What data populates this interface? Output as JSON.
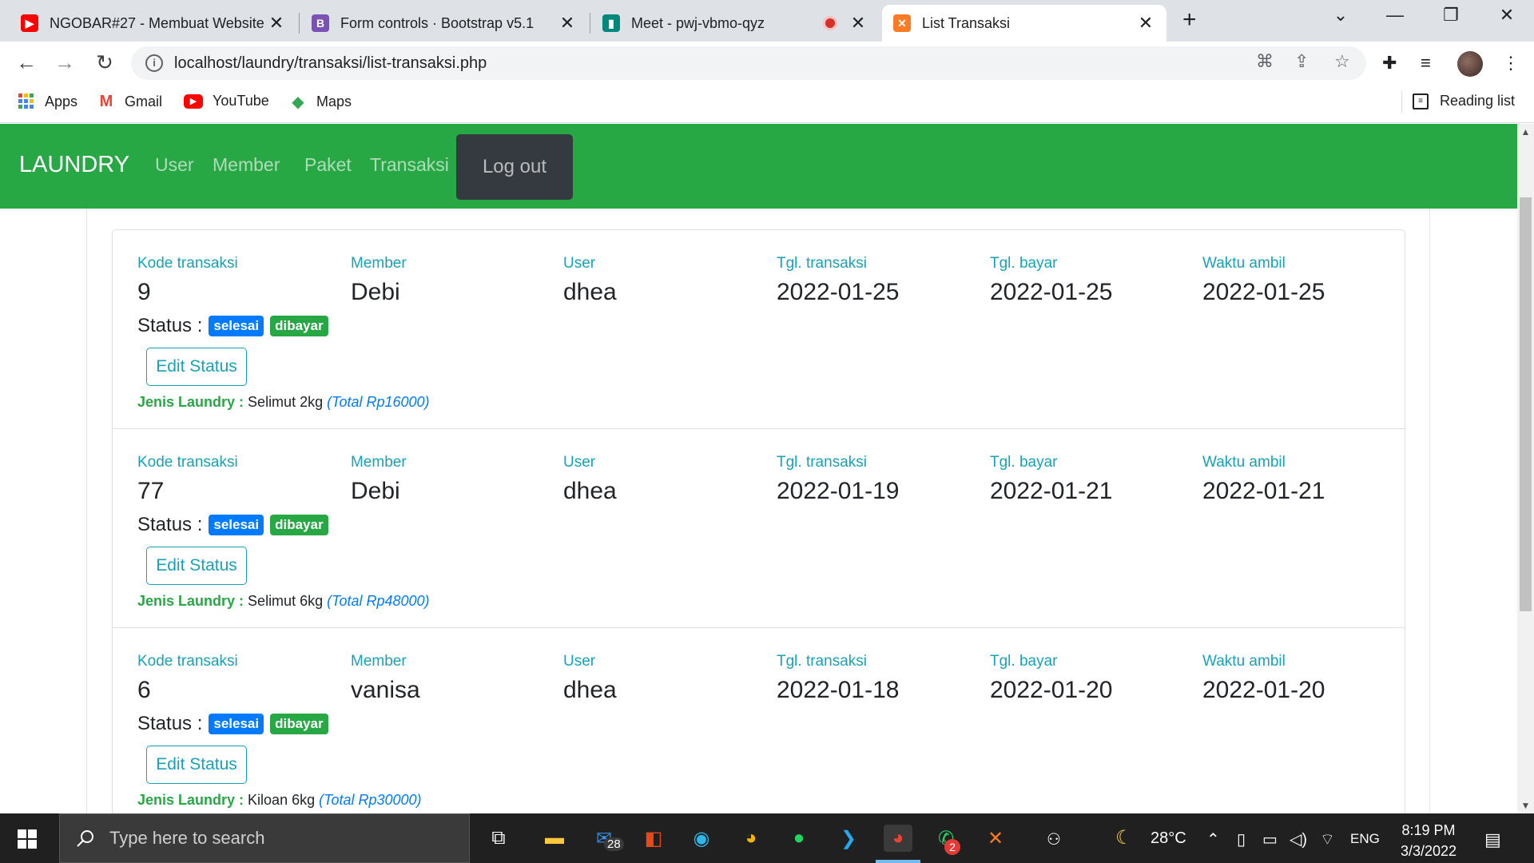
{
  "browser": {
    "tabs": [
      {
        "title": "NGOBAR#27 - Membuat Website",
        "icon": "youtube-icon"
      },
      {
        "title": "Form controls · Bootstrap v5.1",
        "icon": "bootstrap-icon"
      },
      {
        "title": "Meet - pwj-vbmo-qyz",
        "icon": "google-meet-icon"
      },
      {
        "title": "List Transaksi",
        "icon": "xampp-icon"
      }
    ],
    "url": "localhost/laundry/transaksi/list-transaksi.php",
    "bookmarks": [
      "Apps",
      "Gmail",
      "YouTube",
      "Maps"
    ],
    "reading_list": "Reading list"
  },
  "navbar": {
    "brand": "LAUNDRY",
    "links": [
      "User",
      "Member",
      "Paket",
      "Transaksi"
    ],
    "logout": "Log out",
    "color": "#28a745"
  },
  "labels": {
    "kode": "Kode transaksi",
    "member": "Member",
    "user": "User",
    "tgl_transaksi": "Tgl. transaksi",
    "tgl_bayar": "Tgl. bayar",
    "waktu_ambil": "Waktu ambil",
    "status": "Status :",
    "edit": "Edit Status",
    "jenis": "Jenis Laundry :"
  },
  "transactions": [
    {
      "kode": "9",
      "member": "Debi",
      "user": "dhea",
      "tgl_transaksi": "2022-01-25",
      "tgl_bayar": "2022-01-25",
      "waktu_ambil": "2022-01-25",
      "status1": "selesai",
      "status2": "dibayar",
      "jenis": "Selimut 2kg",
      "total": "(Total Rp16000)"
    },
    {
      "kode": "77",
      "member": "Debi",
      "user": "dhea",
      "tgl_transaksi": "2022-01-19",
      "tgl_bayar": "2022-01-21",
      "waktu_ambil": "2022-01-21",
      "status1": "selesai",
      "status2": "dibayar",
      "jenis": "Selimut 6kg",
      "total": "(Total Rp48000)"
    },
    {
      "kode": "6",
      "member": "vanisa",
      "user": "dhea",
      "tgl_transaksi": "2022-01-18",
      "tgl_bayar": "2022-01-20",
      "waktu_ambil": "2022-01-20",
      "status1": "selesai",
      "status2": "dibayar",
      "jenis": "Kiloan 6kg",
      "total": "(Total Rp30000)"
    }
  ],
  "taskbar": {
    "search_placeholder": "Type here to search",
    "mail_badge": "28",
    "whatsapp_badge": "2",
    "temperature": "28°C",
    "language": "ENG",
    "time": "8:19 PM",
    "date": "3/3/2022"
  }
}
